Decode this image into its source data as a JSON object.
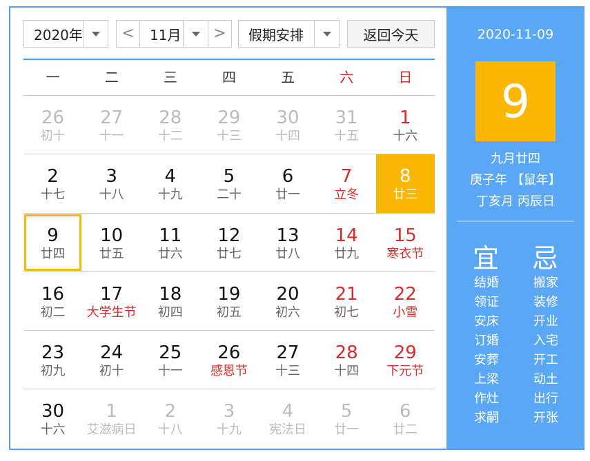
{
  "toolbar": {
    "year": "2020年",
    "prev_glyph": "<",
    "month": "11月",
    "next_glyph": ">",
    "holiday": "假期安排",
    "today_button": "返回今天"
  },
  "weekdays": [
    "一",
    "二",
    "三",
    "四",
    "五",
    "六",
    "日"
  ],
  "weeks": [
    [
      {
        "d": "26",
        "l": "初十",
        "other": true
      },
      {
        "d": "27",
        "l": "十一",
        "other": true
      },
      {
        "d": "28",
        "l": "十二",
        "other": true
      },
      {
        "d": "29",
        "l": "十三",
        "other": true
      },
      {
        "d": "30",
        "l": "十四",
        "other": true
      },
      {
        "d": "31",
        "l": "十五",
        "other": true
      },
      {
        "d": "1",
        "l": "十六",
        "we": true
      }
    ],
    [
      {
        "d": "2",
        "l": "十七"
      },
      {
        "d": "3",
        "l": "十八"
      },
      {
        "d": "4",
        "l": "十九"
      },
      {
        "d": "5",
        "l": "二十"
      },
      {
        "d": "6",
        "l": "廿一"
      },
      {
        "d": "7",
        "l": "立冬",
        "we": true,
        "red": true
      },
      {
        "d": "8",
        "l": "廿三",
        "we": true,
        "sel": true
      }
    ],
    [
      {
        "d": "9",
        "l": "廿四",
        "today": true
      },
      {
        "d": "10",
        "l": "廿五"
      },
      {
        "d": "11",
        "l": "廿六"
      },
      {
        "d": "12",
        "l": "廿七"
      },
      {
        "d": "13",
        "l": "廿八"
      },
      {
        "d": "14",
        "l": "廿九",
        "we": true
      },
      {
        "d": "15",
        "l": "寒衣节",
        "we": true,
        "red": true
      }
    ],
    [
      {
        "d": "16",
        "l": "初二"
      },
      {
        "d": "17",
        "l": "大学生节",
        "red": true
      },
      {
        "d": "18",
        "l": "初四"
      },
      {
        "d": "19",
        "l": "初五"
      },
      {
        "d": "20",
        "l": "初六"
      },
      {
        "d": "21",
        "l": "初七",
        "we": true
      },
      {
        "d": "22",
        "l": "小雪",
        "we": true,
        "red": true
      }
    ],
    [
      {
        "d": "23",
        "l": "初九"
      },
      {
        "d": "24",
        "l": "初十"
      },
      {
        "d": "25",
        "l": "十一"
      },
      {
        "d": "26",
        "l": "感恩节",
        "red": true
      },
      {
        "d": "27",
        "l": "十三"
      },
      {
        "d": "28",
        "l": "十四",
        "we": true
      },
      {
        "d": "29",
        "l": "下元节",
        "we": true,
        "red": true
      }
    ],
    [
      {
        "d": "30",
        "l": "十六"
      },
      {
        "d": "1",
        "l": "艾滋病日",
        "other": true
      },
      {
        "d": "2",
        "l": "十八",
        "other": true
      },
      {
        "d": "3",
        "l": "十九",
        "other": true
      },
      {
        "d": "4",
        "l": "宪法日",
        "other": true
      },
      {
        "d": "5",
        "l": "廿一",
        "other": true
      },
      {
        "d": "6",
        "l": "廿二",
        "other": true
      }
    ]
  ],
  "side": {
    "date": "2020-11-09",
    "big_day": "9",
    "lunar_date": "九月廿四",
    "ganzhi_year": "庚子年 【鼠年】",
    "ganzhi_month_day": "丁亥月 丙辰日",
    "yi_title": "宜",
    "ji_title": "忌",
    "yi_items": [
      "结婚",
      "领证",
      "安床",
      "订婚",
      "安葬",
      "上梁",
      "作灶",
      "求嗣"
    ],
    "ji_items": [
      "搬家",
      "装修",
      "开业",
      "入宅",
      "开工",
      "动土",
      "出行",
      "开张"
    ]
  },
  "colors": {
    "accent": "#4ea0f2",
    "side_bg": "#5aa7f5",
    "highlight": "#fbb601",
    "holiday_red": "#d92b2b"
  }
}
